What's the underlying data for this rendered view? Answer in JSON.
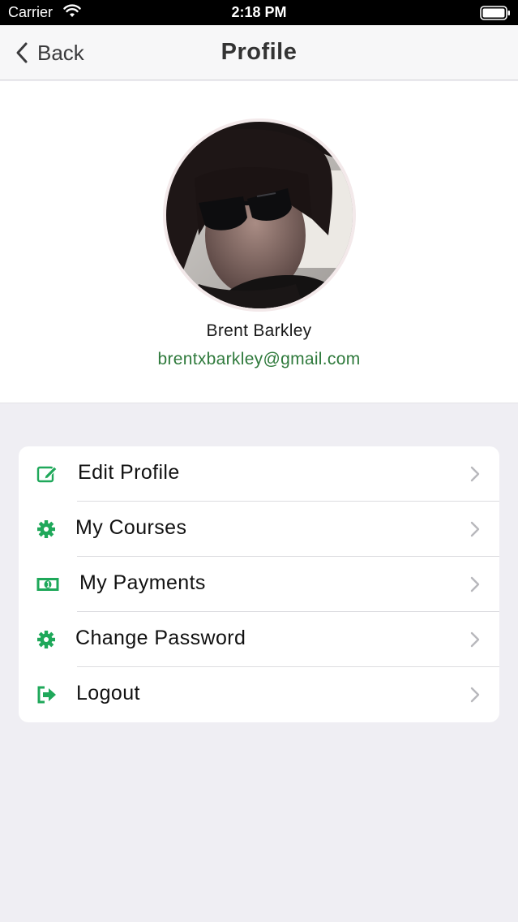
{
  "status_bar": {
    "carrier": "Carrier",
    "time": "2:18 PM"
  },
  "nav": {
    "back_label": "Back",
    "title": "Profile"
  },
  "profile": {
    "name": "Brent Barkley",
    "email": "brentxbarkley@gmail.com"
  },
  "menu": {
    "items": [
      {
        "label": "Edit Profile",
        "icon": "edit-icon"
      },
      {
        "label": "My Courses",
        "icon": "gear-icon"
      },
      {
        "label": "My Payments",
        "icon": "money-icon"
      },
      {
        "label": "Change Password",
        "icon": "gear-icon"
      },
      {
        "label": "Logout",
        "icon": "logout-icon"
      }
    ]
  },
  "colors": {
    "accent_green": "#1fa85a",
    "email_green": "#2f7a3c",
    "background": "#efeef3"
  }
}
